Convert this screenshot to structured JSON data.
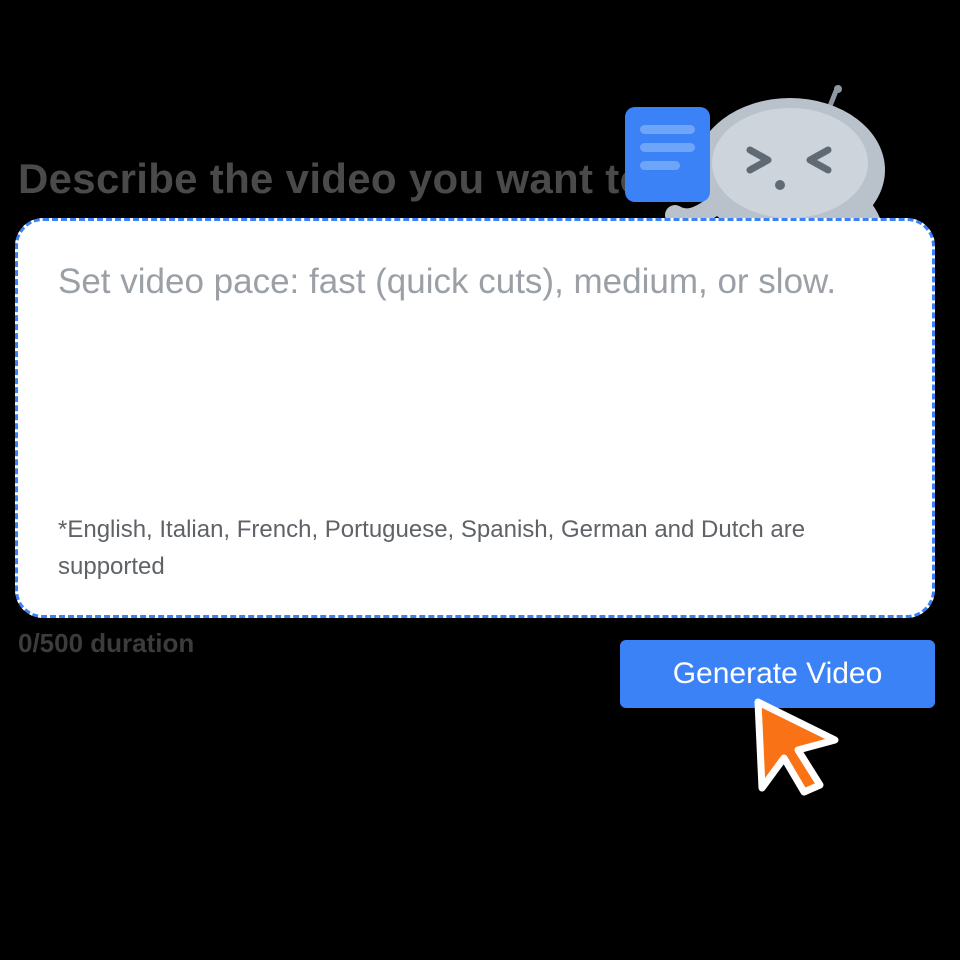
{
  "heading": "Describe the video you want to",
  "input": {
    "placeholder": "Set video pace: fast (quick cuts), medium, or slow.",
    "support_note": "*English, Italian, French, Portuguese, Spanish, German and Dutch are supported"
  },
  "footer_info": "0/500 duration",
  "generate_button": "Generate Video",
  "icons": {
    "document": "document-icon",
    "robot": "robot-icon",
    "pen": "pen-icon",
    "cursor": "cursor-icon"
  },
  "colors": {
    "accent": "#3b82f6",
    "cursor_fill": "#f97316",
    "robot_body": "#b9c2cb",
    "robot_body_light": "#cdd4db"
  }
}
